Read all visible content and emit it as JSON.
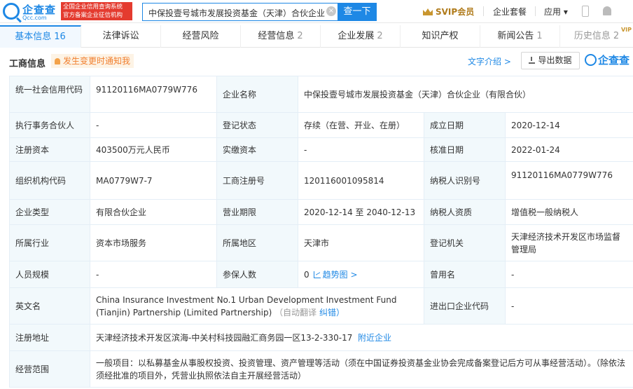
{
  "header": {
    "logo_name": "企查查",
    "logo_domain": "Qcc.com",
    "gov_badge_line1": "全国企业信用查询系统",
    "gov_badge_line2": "官方备案企业征信机构",
    "search_value": "中保投壹号城市发展投资基金（天津）合伙企业",
    "search_button": "查一下",
    "svip": "SVIP会员",
    "suite": "企业套餐",
    "app": "应用 ▾"
  },
  "tabs": [
    {
      "label": "基本信息",
      "count": "16"
    },
    {
      "label": "法律诉讼",
      "count": ""
    },
    {
      "label": "经营风险",
      "count": ""
    },
    {
      "label": "经营信息",
      "count": "2"
    },
    {
      "label": "企业发展",
      "count": "2"
    },
    {
      "label": "知识产权",
      "count": ""
    },
    {
      "label": "新闻公告",
      "count": "1"
    },
    {
      "label": "历史信息",
      "count": "2",
      "tag": "VIP"
    }
  ],
  "section": {
    "title": "工商信息",
    "notify": "发生变更时通知我",
    "text_intro": "文字介绍 >",
    "export": "导出数据",
    "brand": "企查查"
  },
  "info": {
    "credit_code_label": "统一社会信用代码",
    "credit_code": "91120116MA0779W776",
    "company_name_label": "企业名称",
    "company_name": "中保投壹号城市发展投资基金（天津）合伙企业（有限合伙）",
    "partner_label": "执行事务合伙人",
    "partner": "-",
    "status_label": "登记状态",
    "status": "存续（在营、开业、在册）",
    "est_date_label": "成立日期",
    "est_date": "2020-12-14",
    "reg_capital_label": "注册资本",
    "reg_capital": "403500万元人民币",
    "paid_capital_label": "实缴资本",
    "paid_capital": "-",
    "approve_date_label": "核准日期",
    "approve_date": "2022-01-24",
    "org_code_label": "组织机构代码",
    "org_code": "MA0779W7-7",
    "reg_no_label": "工商注册号",
    "reg_no": "120116001095814",
    "taxpayer_id_label": "纳税人识别号",
    "taxpayer_id": "91120116MA0779W776",
    "type_label": "企业类型",
    "type": "有限合伙企业",
    "term_label": "营业期限",
    "term": "2020-12-14 至 2040-12-13",
    "taxpayer_qual_label": "纳税人资质",
    "taxpayer_qual": "增值税一般纳税人",
    "industry_label": "所属行业",
    "industry": "资本市场服务",
    "region_label": "所属地区",
    "region": "天津市",
    "authority_label": "登记机关",
    "authority": "天津经济技术开发区市场监督管理局",
    "staff_label": "人员规模",
    "staff": "-",
    "insured_label": "参保人数",
    "insured": "0",
    "trend_link": "趋势图 >",
    "former_name_label": "曾用名",
    "former_name": "-",
    "english_label": "英文名",
    "english": "China Insurance Investment No.1 Urban Development Investment Fund (Tianjin) Partnership (Limited Partnership)",
    "auto_translate": "（自动翻译",
    "correct": "纠错）",
    "io_code_label": "进出口企业代码",
    "io_code": "-",
    "address_label": "注册地址",
    "address": "天津经济技术开发区滨海-中关村科技园融汇商务园一区13-2-330-17",
    "nearby": "附近企业",
    "scope_label": "经营范围",
    "scope": "一般项目：以私募基金从事股权投资、投资管理、资产管理等活动（须在中国证券投资基金业协会完成备案登记后方可从事经营活动）。（除依法须经批准的项目外，凭营业执照依法自主开展经营活动）"
  }
}
